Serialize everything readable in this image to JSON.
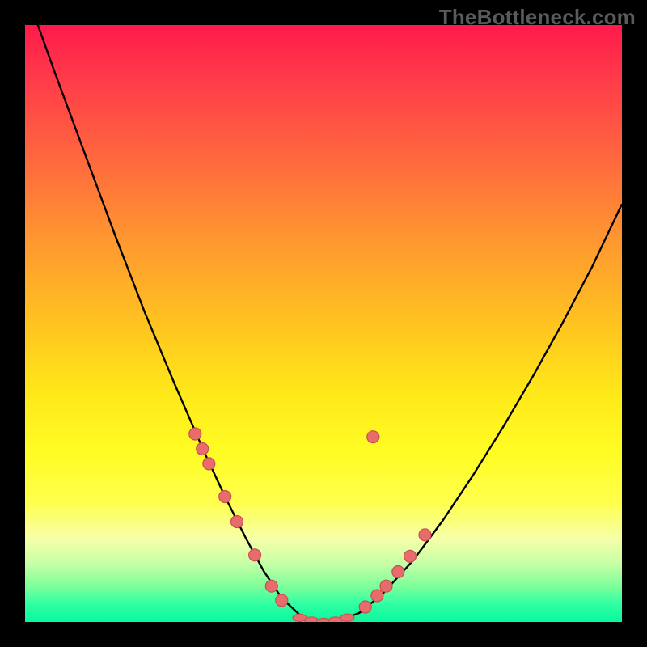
{
  "watermark": "TheBottleneck.com",
  "chart_data": {
    "type": "line",
    "title": "",
    "xlabel": "",
    "ylabel": "",
    "xlim": [
      0,
      100
    ],
    "ylim": [
      0,
      100
    ],
    "series": [
      {
        "name": "bottleneck-curve",
        "x": [
          0,
          5,
          10,
          15,
          20,
          25,
          30,
          33.5,
          37,
          40,
          43,
          46,
          48,
          52,
          56,
          60,
          65,
          70,
          75,
          80,
          85,
          90,
          95,
          100
        ],
        "y": [
          106,
          92,
          78.5,
          65,
          52,
          40,
          28.5,
          21,
          14,
          8.5,
          4,
          1.2,
          0,
          0,
          1.5,
          4.8,
          10.3,
          17,
          24.5,
          32.5,
          41,
          50,
          59.5,
          70
        ]
      }
    ],
    "markers": {
      "left_branch": [
        {
          "x": 28.5,
          "y": 31.5
        },
        {
          "x": 29.7,
          "y": 29.0
        },
        {
          "x": 30.8,
          "y": 26.5
        },
        {
          "x": 33.5,
          "y": 21.0
        },
        {
          "x": 35.5,
          "y": 16.8
        },
        {
          "x": 38.5,
          "y": 11.2
        },
        {
          "x": 41.3,
          "y": 6.0
        },
        {
          "x": 43.0,
          "y": 3.6
        }
      ],
      "flat": [
        {
          "x": 46.0,
          "y": 0.7
        },
        {
          "x": 48.0,
          "y": 0.2
        },
        {
          "x": 50.0,
          "y": 0.0
        },
        {
          "x": 52.0,
          "y": 0.2
        },
        {
          "x": 54.0,
          "y": 0.7
        }
      ],
      "right_branch": [
        {
          "x": 57.0,
          "y": 2.5
        },
        {
          "x": 59.0,
          "y": 4.4
        },
        {
          "x": 60.5,
          "y": 6.0
        },
        {
          "x": 62.5,
          "y": 8.4
        },
        {
          "x": 64.5,
          "y": 11.0
        },
        {
          "x": 67.0,
          "y": 14.6
        },
        {
          "x": 58.3,
          "y": 31.0
        }
      ]
    },
    "gradient_colors": {
      "top": "#ff1a4b",
      "mid": "#ffe919",
      "bottom": "#08f89d"
    }
  }
}
